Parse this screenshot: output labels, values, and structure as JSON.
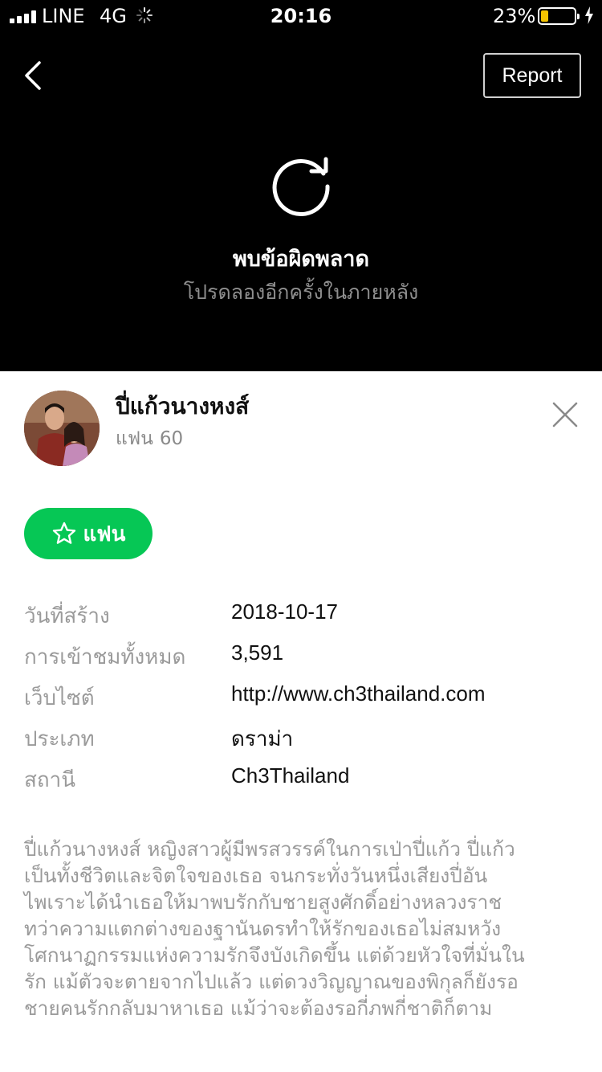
{
  "status_bar": {
    "carrier": "LINE",
    "network": "4G",
    "time": "20:16",
    "battery_percent": "23%",
    "battery_level": 0.23,
    "battery_color": "#f5c400"
  },
  "header": {
    "back_icon": "chevron-left-icon",
    "report_label": "Report"
  },
  "player_error": {
    "icon": "reload-icon",
    "title": "พบข้อผิดพลาด",
    "subtitle": "โปรดลองอีกครั้งในภายหลัง"
  },
  "channel": {
    "name": "ปี่แก้วนางหงส์",
    "fans_label": "แฟน",
    "fans_count": "60",
    "avatar": "channel-avatar"
  },
  "fan_button": {
    "label": "แฟน",
    "icon": "star-outline-icon",
    "color": "#06c755"
  },
  "info": [
    {
      "label": "วันที่สร้าง",
      "value": "2018-10-17"
    },
    {
      "label": "การเข้าชมทั้งหมด",
      "value": "3,591"
    },
    {
      "label": "เว็บไซต์",
      "value": "http://www.ch3thailand.com"
    },
    {
      "label": "ประเภท",
      "value": "ดราม่า"
    },
    {
      "label": "สถานี",
      "value": "Ch3Thailand"
    }
  ],
  "description": [
    "ปี่แก้วนางหงส์ หญิงสาวผู้มีพรสวรรค์ในการเป่าปี่แก้ว ปี่แก้ว",
    "เป็นทั้งชีวิตและจิตใจของเธอ จนกระทั่งวันหนึ่งเสียงปี่อัน",
    "ไพเราะได้นำเธอให้มาพบรักกับชายสูงศักดิ์อย่างหลวงราช",
    "ทว่าความแตกต่างของฐานันดรทำให้รักของเธอไม่สมหวัง",
    "โศกนาฏกรรมแห่งความรักจึงบังเกิดขึ้น แต่ด้วยหัวใจที่มั่นใน",
    "รัก แม้ตัวจะตายจากไปแล้ว แต่ดวงวิญญาณของพิกุลก็ยังรอ",
    "ชายคนรักกลับมาหาเธอ แม้ว่าจะต้องรอกี่ภพกี่ชาติก็ตาม"
  ]
}
